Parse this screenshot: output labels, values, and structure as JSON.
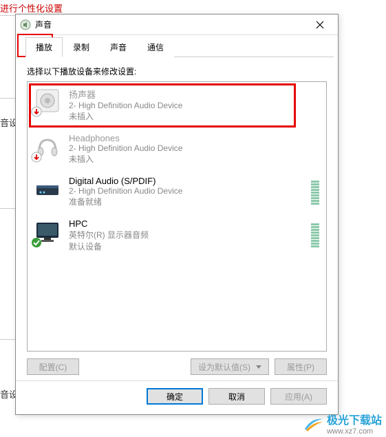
{
  "background": {
    "top_text": "进行个性化设置",
    "side_label_1": "音设",
    "side_label_2": "音设"
  },
  "dialog": {
    "title": "声音",
    "close": "×"
  },
  "tabs": [
    {
      "label": "播放",
      "active": true
    },
    {
      "label": "录制",
      "active": false
    },
    {
      "label": "声音",
      "active": false
    },
    {
      "label": "通信",
      "active": false
    }
  ],
  "instruction": "选择以下播放设备来修改设置:",
  "devices": [
    {
      "name": "扬声器",
      "sub": "2- High Definition Audio Device",
      "status": "未插入",
      "overlay": "down",
      "disabled": true,
      "level": false,
      "highlight": true,
      "icon": "speaker"
    },
    {
      "name": "Headphones",
      "sub": "2- High Definition Audio Device",
      "status": "未插入",
      "overlay": "down",
      "disabled": true,
      "level": false,
      "icon": "headphones"
    },
    {
      "name": "Digital Audio (S/PDIF)",
      "sub": "2- High Definition Audio Device",
      "status": "准备就绪",
      "overlay": null,
      "disabled": false,
      "level": true,
      "icon": "spdif"
    },
    {
      "name": "HPC",
      "sub": "英特尔(R) 显示器音频",
      "status": "默认设备",
      "overlay": "check",
      "disabled": false,
      "level": true,
      "icon": "monitor"
    }
  ],
  "action_buttons": {
    "configure": "配置(C)",
    "set_default": "设为默认值(S)",
    "properties": "属性(P)"
  },
  "footer": {
    "ok": "确定",
    "cancel": "取消",
    "apply": "应用(A)"
  },
  "watermark": {
    "name": "极光下载站",
    "url": "www.xz7.com"
  }
}
